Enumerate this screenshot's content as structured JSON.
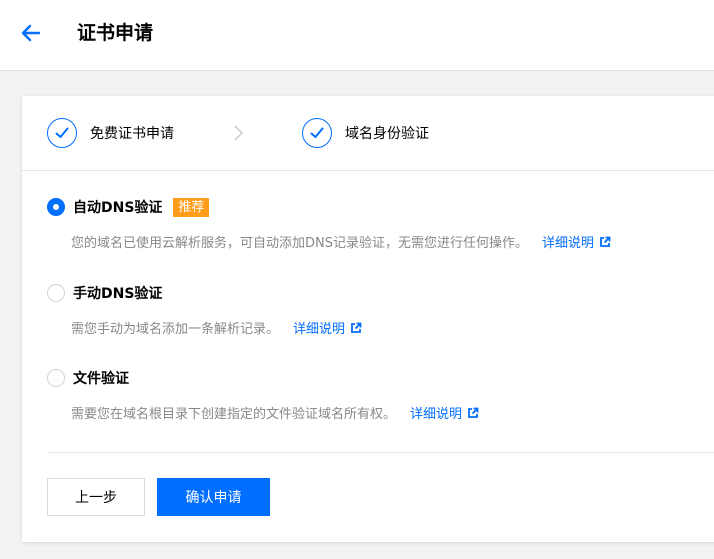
{
  "header": {
    "title": "证书申请",
    "back_icon": "arrow-left-icon"
  },
  "steps": [
    {
      "label": "免费证书申请",
      "status": "done"
    },
    {
      "label": "域名身份验证",
      "status": "done"
    }
  ],
  "options": [
    {
      "label": "自动DNS验证",
      "badge": "推荐",
      "checked": true,
      "description": "您的域名已使用云解析服务，可自动添加DNS记录验证，无需您进行任何操作。",
      "link": "详细说明"
    },
    {
      "label": "手动DNS验证",
      "checked": false,
      "description": "需您手动为域名添加一条解析记录。",
      "link": "详细说明"
    },
    {
      "label": "文件验证",
      "checked": false,
      "description": "需要您在域名根目录下创建指定的文件验证域名所有权。",
      "link": "详细说明"
    }
  ],
  "buttons": {
    "prev": "上一步",
    "confirm": "确认申请"
  },
  "colors": {
    "primary": "#006eff",
    "badge": "#ff9c19",
    "muted_text": "#888888"
  }
}
